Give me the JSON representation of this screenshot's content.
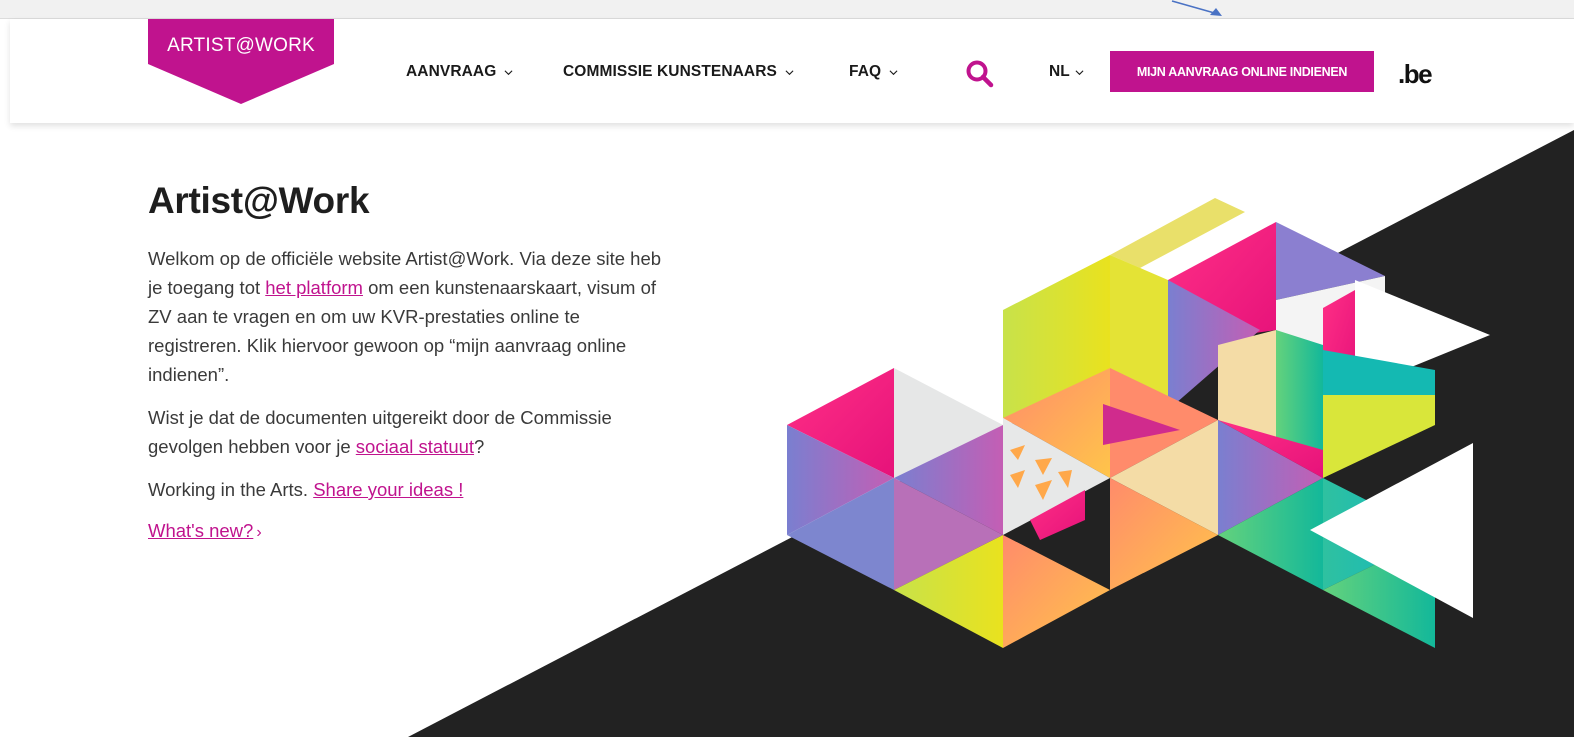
{
  "brand": {
    "logo_text": "ARTIST@WORK",
    "be_logo": ".be",
    "accent_color": "#c0138e"
  },
  "nav": {
    "items": [
      {
        "label": "AANVRAAG"
      },
      {
        "label": "COMMISSIE KUNSTENAARS"
      },
      {
        "label": "FAQ"
      }
    ],
    "search_icon": "search-icon",
    "language": "NL",
    "cta_label": "MIJN AANVRAAG ONLINE INDIENEN"
  },
  "main": {
    "title": "Artist@Work",
    "p1_before": "Welkom op de officiële website Artist@Work. Via deze site heb je toegang tot ",
    "p1_link": "het platform",
    "p1_after": " om een kunstenaarskaart, visum of ZV aan te vragen en om uw KVR-prestaties online te registreren. Klik hiervoor gewoon op “mijn aanvraag online indienen”.",
    "p2_before": "Wist je dat de documenten uitgereikt door de Commissie gevolgen hebben voor je ",
    "p2_link": "sociaal statuut",
    "p2_after": "?",
    "p3_before": "Working in the Arts. ",
    "p3_link": "Share your ideas !",
    "whats_new": "What's new?",
    "whats_new_arrow": "›"
  }
}
